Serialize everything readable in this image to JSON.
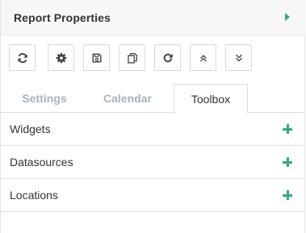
{
  "header": {
    "title": "Report Properties",
    "expand_icon": "caret-right-icon",
    "accent_color": "#35a987"
  },
  "toolbar": {
    "buttons": [
      {
        "name": "refresh-button",
        "icon": "refresh-icon"
      },
      {
        "name": "settings-button",
        "icon": "gear-icon"
      },
      {
        "name": "save-button",
        "icon": "save-icon"
      },
      {
        "name": "copy-button",
        "icon": "copy-icon"
      },
      {
        "name": "redo-button",
        "icon": "redo-icon"
      },
      {
        "name": "collapse-all-button",
        "icon": "chevrons-up-icon"
      },
      {
        "name": "expand-all-button",
        "icon": "chevrons-down-icon"
      }
    ]
  },
  "tabs": [
    {
      "label": "Settings",
      "active": false
    },
    {
      "label": "Calendar",
      "active": false
    },
    {
      "label": "Toolbox",
      "active": true
    }
  ],
  "sections": [
    {
      "label": "Widgets",
      "icon": "plus-icon"
    },
    {
      "label": "Datasources",
      "icon": "plus-icon"
    },
    {
      "label": "Locations",
      "icon": "plus-icon"
    }
  ]
}
